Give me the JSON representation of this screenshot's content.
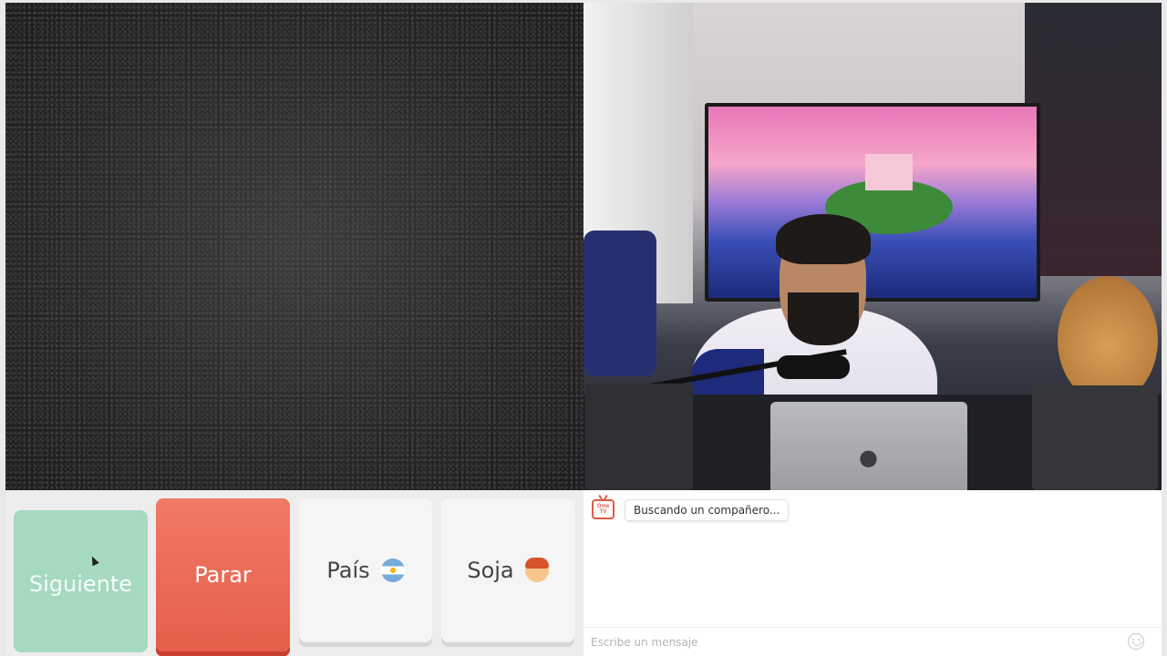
{
  "controls": {
    "next_label": "Siguiente",
    "stop_label": "Parar",
    "country_label": "País",
    "country_icon": "argentina-flag-icon",
    "gender_label": "Soja",
    "gender_icon": "boy-emoji-icon",
    "next_color": "#a5d9c0",
    "stop_color": "#e86a55"
  },
  "chat": {
    "logo_text": "Ome TV",
    "status_message": "Buscando un compañero...",
    "input_placeholder": "Escribe un mensaje"
  },
  "self_video": {
    "laptop_icon": "apple-logo-icon"
  }
}
